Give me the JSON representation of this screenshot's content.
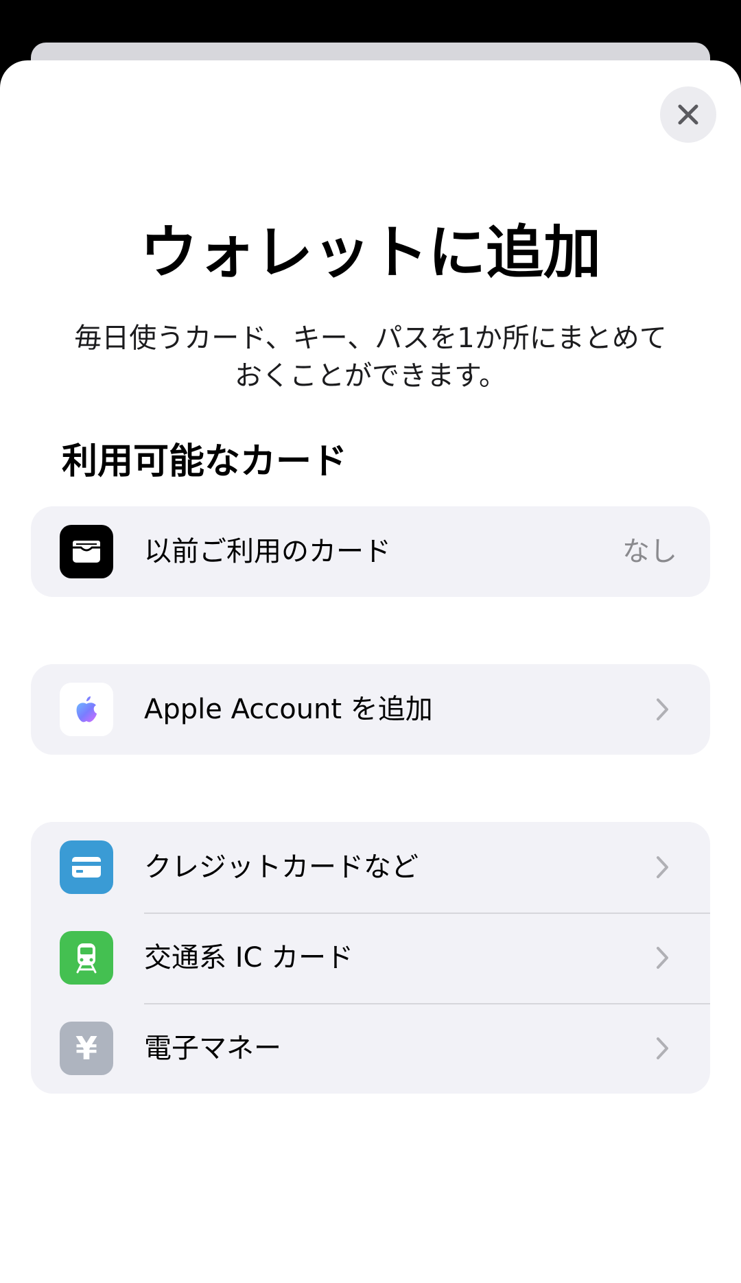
{
  "sheet": {
    "title": "ウォレットに追加",
    "subtitle_line1": "毎日使うカード、キー、パスを1か所にまとめて",
    "subtitle_line2": "おくことができます。",
    "close_icon": "close-icon"
  },
  "available_cards": {
    "header": "利用可能なカード",
    "previous": {
      "label": "以前ご利用のカード",
      "value": "なし",
      "icon": "wallet-icon"
    },
    "apple_account": {
      "label": "Apple Account を追加",
      "icon": "apple-logo-icon"
    },
    "card_types": [
      {
        "label": "クレジットカードなど",
        "icon": "credit-card-icon",
        "icon_color": "#3a9bd5"
      },
      {
        "label": "交通系 IC カード",
        "icon": "train-icon",
        "icon_color": "#44c051"
      },
      {
        "label": "電子マネー",
        "icon": "yen-icon",
        "icon_glyph": "¥",
        "icon_color": "#aeb4bf"
      }
    ]
  }
}
